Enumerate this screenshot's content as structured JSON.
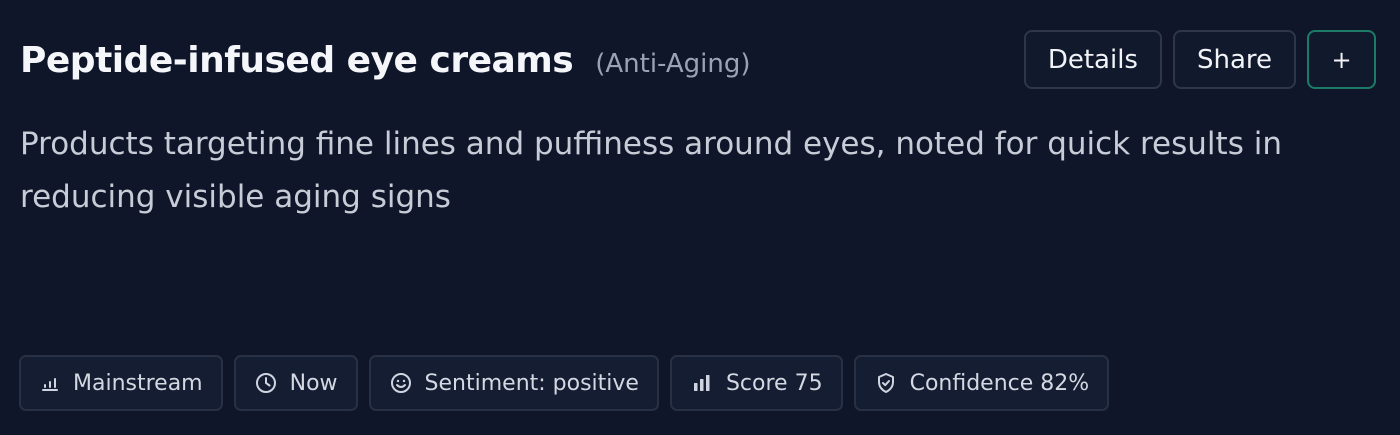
{
  "card": {
    "title": "Peptide-infused eye creams",
    "category": "(Anti-Aging)",
    "description": "Products targeting fine lines and puffiness around eyes, noted for quick results in reducing visible aging signs"
  },
  "actions": {
    "details_label": "Details",
    "share_label": "Share",
    "add_label": "+"
  },
  "tags": [
    {
      "icon": "bar-chart-icon",
      "label": "Mainstream"
    },
    {
      "icon": "clock-icon",
      "label": "Now"
    },
    {
      "icon": "smiley-icon",
      "label": "Sentiment: positive"
    },
    {
      "icon": "bar-chart-icon",
      "label": "Score 75"
    },
    {
      "icon": "shield-check-icon",
      "label": "Confidence 82%"
    }
  ],
  "colors": {
    "background": "#0f1629",
    "border": "#2e3648",
    "accent_border": "#1d7a66",
    "muted_text": "#9aa3b4"
  }
}
